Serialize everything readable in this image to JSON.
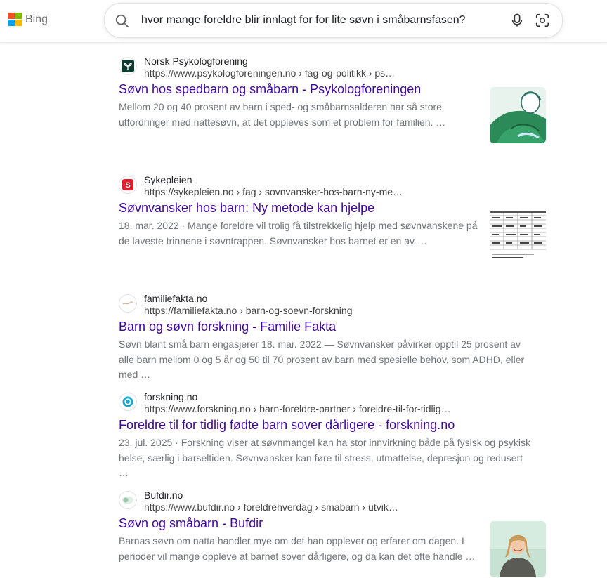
{
  "brand": {
    "name": "Bing",
    "logo_colors": [
      "#f25022",
      "#7fba00",
      "#00a4ef",
      "#ffb900"
    ]
  },
  "search": {
    "query": "hvor mange foreldre blir innlagt for for lite søvn i småbarnsfasen?"
  },
  "colors": {
    "title_link": "#4007a2",
    "snippet": "#70757a",
    "url": "#444444"
  },
  "results": [
    {
      "site": "Norsk Psykologforening",
      "url": "https://www.psykologforeningen.no › fag-og-politikk › ps…",
      "title": "Søvn hos spedbarn og småbarn - Psykologforeningen",
      "snippet": "Mellom 20 og 40 prosent av barn i sped- og småbarnsalderen har så store utfordringer med nattesøvn, at det oppleves som et problem for familien. …",
      "favicon": "psykologforeningen-leaf-icon",
      "thumbnail": "illustration-mother-child"
    },
    {
      "site": "Sykepleien",
      "url": "https://sykepleien.no › fag › sovnvansker-hos-barn-ny-me…",
      "title": "Søvnvansker hos barn: Ny metode kan hjelpe",
      "snippet": "18. mar. 2022 · Mange foreldre vil trolig få tilstrekkelig hjelp med søvnvanskene på de laveste trinnene i søvntrappen. Søvnvansker hos barnet er en av …",
      "favicon": "sykepleien-s-icon",
      "thumbnail": "table-document"
    },
    {
      "site": "familiefakta.no",
      "url": "https://familiefakta.no › barn-og-soevn-forskning",
      "title": "Barn og søvn forskning - Familie Fakta",
      "snippet": "Søvn blant små barn engasjerer 18. mar. 2022 — Søvnvansker påvirker opptil 25 prosent av alle barn mellom 0 og 5 år og 50 til 70 prosent av barn med spesielle behov, som ADHD, eller med …",
      "favicon": "familiefakta-icon"
    },
    {
      "site": "forskning.no",
      "url": "https://www.forskning.no › barn-foreldre-partner › foreldre-til-for-tidlig…",
      "title": "Foreldre til for tidlig fødte barn sover dårligere - forskning.no",
      "snippet": "23. jul. 2025 · Forskning viser at søvnmangel kan ha stor innvirkning både på fysisk og psykisk helse, særlig i barseltiden. Søvnvansker kan føre til stress, utmattelse, depresjon og redusert …",
      "favicon": "forskning-ring-icon"
    },
    {
      "site": "Bufdir.no",
      "url": "https://www.bufdir.no › foreldrehverdag › smabarn › utvik…",
      "title": "Søvn og småbarn - Bufdir",
      "snippet": "Barnas søvn om natta handler mye om det han opplever og erfarer om dagen. I perioder vil mange oppleve at barnet sover dårligere, og da kan det ofte handle …",
      "favicon": "bufdir-toggle-icon",
      "thumbnail": "photo-smiling-woman"
    }
  ]
}
